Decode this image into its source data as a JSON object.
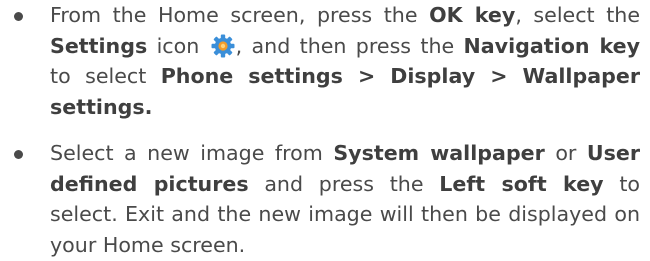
{
  "bullets": [
    {
      "segments": [
        {
          "text": "From the Home screen, press the ",
          "bold": false
        },
        {
          "text": "OK key",
          "bold": true
        },
        {
          "text": ", select the ",
          "bold": false
        },
        {
          "text": "Settings",
          "bold": true
        },
        {
          "text": " icon ",
          "bold": false
        },
        {
          "icon": "settings-gear-icon"
        },
        {
          "text": ", and then press the ",
          "bold": false
        },
        {
          "text": "Navigation key",
          "bold": true
        },
        {
          "text": " to select ",
          "bold": false
        },
        {
          "text": "Phone settings > Display > Wallpaper settings.",
          "bold": true
        }
      ]
    },
    {
      "segments": [
        {
          "text": "Select a new image from ",
          "bold": false
        },
        {
          "text": "System wallpaper",
          "bold": true
        },
        {
          "text": " or ",
          "bold": false
        },
        {
          "text": "User defined pictures",
          "bold": true
        },
        {
          "text": " and press the ",
          "bold": false
        },
        {
          "text": "Left soft key",
          "bold": true
        },
        {
          "text": " to select. Exit and the new image will then be displayed on your Home screen.",
          "bold": false
        }
      ]
    }
  ],
  "colors": {
    "text": "#4a4a4a",
    "gear_blue": "#3b8fd9",
    "gear_orange": "#f39c2a"
  }
}
